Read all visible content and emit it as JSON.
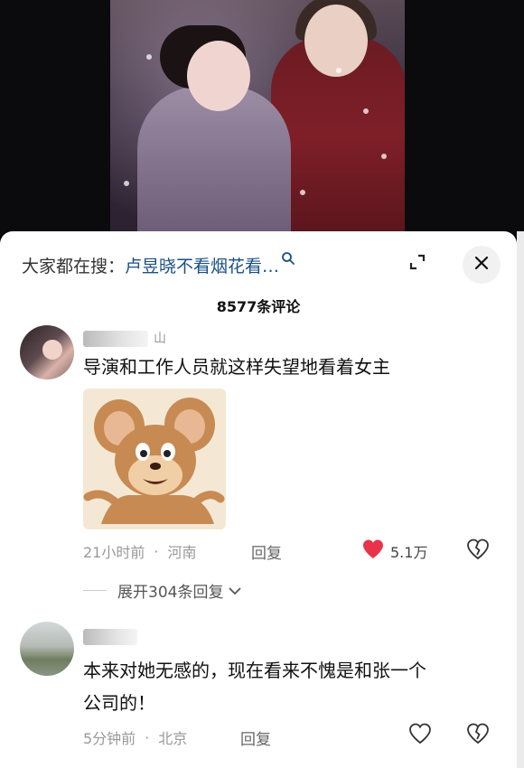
{
  "header": {
    "search_prefix": "大家都在搜：",
    "search_query": "卢昱晓不看烟花看…",
    "comment_count": "8577条评论"
  },
  "comments": [
    {
      "username": "山",
      "text": "导演和工作人员就这样失望地看着女主",
      "has_sticker": true,
      "time": "21小时前",
      "location": "河南",
      "reply_label": "回复",
      "likes": "5.1万",
      "liked": true,
      "expand_label": "展开304条回复"
    },
    {
      "username": "",
      "text_line1": "本来对她无感的，现在看来不愧是和张一个",
      "text_line2": "公司的！",
      "time": "5分钟前",
      "location": "北京",
      "reply_label": "回复",
      "likes": "",
      "liked": false
    }
  ],
  "colors": {
    "accent_blue": "#1a4f86",
    "like_red": "#e8334a",
    "meta_gray": "#999999"
  }
}
